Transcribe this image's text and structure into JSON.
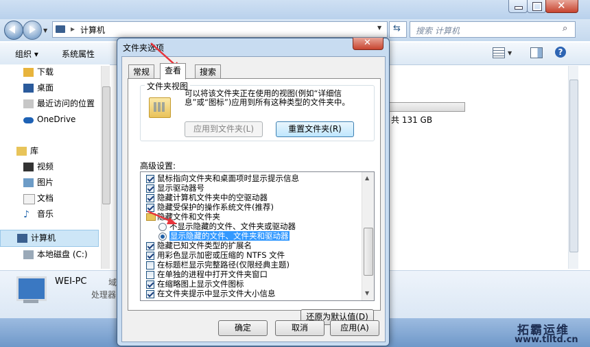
{
  "explorer": {
    "breadcrumb": "计算机",
    "search_placeholder": "搜索 计算机",
    "toolbar": {
      "organize": "组织 ▾",
      "system_properties": "系统属性"
    },
    "nav": {
      "favorites": [
        "下载",
        "桌面",
        "最近访问的位置"
      ],
      "onedrive": "OneDrive",
      "library": "库",
      "library_items": [
        "视频",
        "图片",
        "文档",
        "音乐"
      ],
      "computer": "计算机",
      "local_disk": "本地磁盘 (C:)"
    },
    "drive_info": "共 131 GB",
    "details": {
      "pc_name": "WEI-PC",
      "domain_label": "域",
      "processor_label": "处理器"
    }
  },
  "dialog": {
    "title": "文件夹选项",
    "tabs": [
      "常规",
      "查看",
      "搜索"
    ],
    "folder_views": {
      "legend": "文件夹视图",
      "description": "可以将该文件夹正在使用的视图(例如“详细信息”或“图标”)应用到所有这种类型的文件夹中。",
      "apply_button": "应用到文件夹(L)",
      "reset_button": "重置文件夹(R)"
    },
    "advanced_label": "高级设置:",
    "settings": [
      {
        "type": "checkbox",
        "checked": true,
        "label": "鼠标指向文件夹和桌面项时显示提示信息"
      },
      {
        "type": "checkbox",
        "checked": true,
        "label": "显示驱动器号"
      },
      {
        "type": "checkbox",
        "checked": true,
        "label": "隐藏计算机文件夹中的空驱动器"
      },
      {
        "type": "checkbox",
        "checked": true,
        "label": "隐藏受保护的操作系统文件(推荐)"
      },
      {
        "type": "folder",
        "checked": false,
        "label": "隐藏文件和文件夹"
      },
      {
        "type": "radio",
        "checked": false,
        "label": "不显示隐藏的文件、文件夹或驱动器"
      },
      {
        "type": "radio",
        "checked": true,
        "selected": true,
        "label": "显示隐藏的文件、文件夹和驱动器"
      },
      {
        "type": "checkbox",
        "checked": true,
        "label": "隐藏已知文件类型的扩展名"
      },
      {
        "type": "checkbox",
        "checked": true,
        "label": "用彩色显示加密或压缩的 NTFS 文件"
      },
      {
        "type": "checkbox",
        "checked": false,
        "label": "在标题栏显示完整路径(仅限经典主题)"
      },
      {
        "type": "checkbox",
        "checked": false,
        "label": "在单独的进程中打开文件夹窗口"
      },
      {
        "type": "checkbox",
        "checked": true,
        "label": "在缩略图上显示文件图标"
      },
      {
        "type": "checkbox",
        "checked": true,
        "label": "在文件夹提示中显示文件大小信息"
      }
    ],
    "restore_button": "还原为默认值(D)",
    "ok_button": "确定",
    "cancel_button": "取消",
    "apply_button": "应用(A)"
  },
  "watermark": {
    "text": "拓霸运维",
    "url": "www.tlltd.cn"
  },
  "colors": {
    "annotation_arrow": "#e8343b",
    "selection": "#3399ff"
  }
}
